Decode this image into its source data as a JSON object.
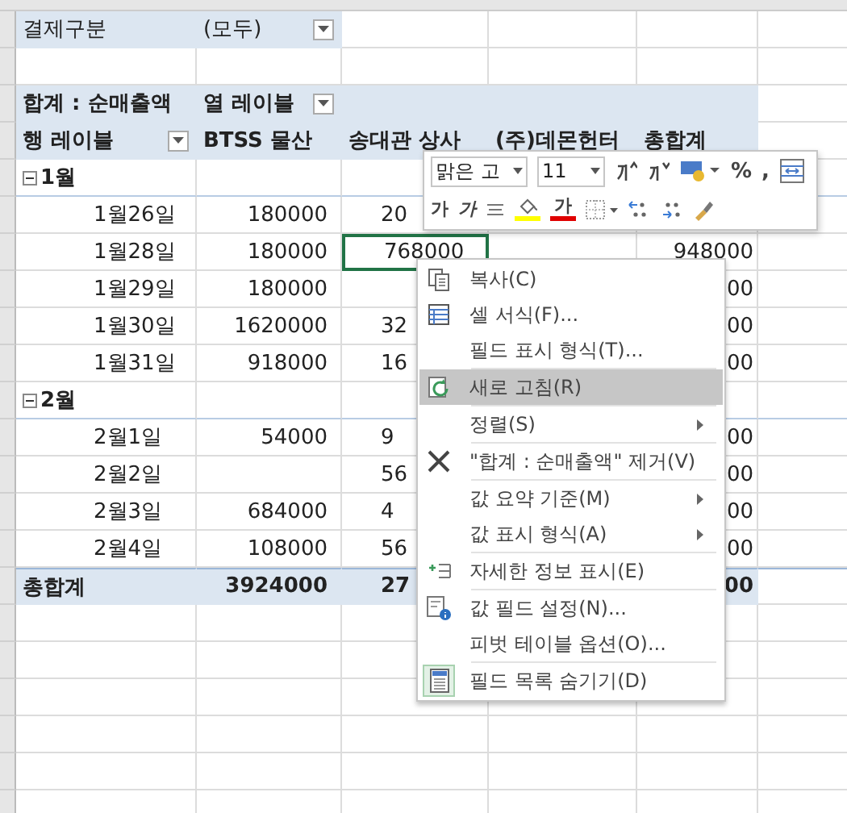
{
  "page_filter": {
    "label": "결제구분",
    "value": "(모두)"
  },
  "pivot": {
    "value_label": "합계 : 순매출액",
    "column_label": "열 레이블",
    "row_label": "행 레이블",
    "columns": [
      "BTSS 물산",
      "송대관 상사",
      "(주)데몬헌터",
      "총합계"
    ],
    "groups": [
      {
        "label": "1월",
        "expanded": true,
        "rows": [
          {
            "label": "1월26일",
            "col_1": "180000",
            "col_2": "20",
            "selected_cells": [
              false,
              false,
              false,
              false
            ]
          },
          {
            "label": "1월28일",
            "col_1": "180000",
            "col_2": "768000",
            "col_4": "948000",
            "selected_cells": [
              false,
              true,
              false,
              false
            ]
          },
          {
            "label": "1월29일",
            "col_1": "180000",
            "col_4": "00",
            "selected_cells": [
              false,
              false,
              false,
              false
            ]
          },
          {
            "label": "1월30일",
            "col_1": "1620000",
            "col_2": "32",
            "col_4": "00",
            "selected_cells": [
              false,
              false,
              false,
              false
            ]
          },
          {
            "label": "1월31일",
            "col_1": "918000",
            "col_2": "16",
            "col_4": "00",
            "selected_cells": [
              false,
              false,
              false,
              false
            ]
          }
        ]
      },
      {
        "label": "2월",
        "expanded": true,
        "rows": [
          {
            "label": "2월1일",
            "col_1": "54000",
            "col_2": "9",
            "col_4": "00",
            "selected_cells": [
              false,
              false,
              false,
              false
            ]
          },
          {
            "label": "2월2일",
            "col_2": "56",
            "col_4": "00",
            "selected_cells": [
              false,
              false,
              false,
              false
            ]
          },
          {
            "label": "2월3일",
            "col_1": "684000",
            "col_2": "4",
            "col_4": "00",
            "selected_cells": [
              false,
              false,
              false,
              false
            ]
          },
          {
            "label": "2월4일",
            "col_1": "108000",
            "col_2": "56",
            "col_4": "00",
            "selected_cells": [
              false,
              false,
              false,
              false
            ]
          }
        ]
      }
    ],
    "grand_total": {
      "label": "총합계",
      "col_1": "3924000",
      "col_2": "27",
      "col_4": "00"
    }
  },
  "mini_toolbar": {
    "font": "맑은 고",
    "size": "11",
    "rows": [
      [
        {
          "kind": "grow"
        },
        {
          "kind": "shrink"
        },
        {
          "kind": "accounting"
        },
        {
          "kind": "text",
          "text": "%"
        },
        {
          "kind": "text",
          "text": ","
        },
        {
          "kind": "wrap"
        }
      ],
      [
        {
          "kind": "bold",
          "text": "가"
        },
        {
          "kind": "italic",
          "text": "가"
        },
        {
          "kind": "align"
        },
        {
          "kind": "fill",
          "color": "#ffff00"
        },
        {
          "kind": "fontcolor",
          "text": "가",
          "color": "#e00000"
        },
        {
          "kind": "border"
        },
        {
          "kind": "incdec"
        },
        {
          "kind": "decdec"
        },
        {
          "kind": "painter"
        }
      ]
    ]
  },
  "context_menu": [
    {
      "kind": "item",
      "label": "복사(C)",
      "submenu": false,
      "selected": false
    },
    {
      "kind": "item",
      "label": "셀 서식(F)...",
      "submenu": false,
      "selected": false
    },
    {
      "kind": "item",
      "label": "필드 표시 형식(T)...",
      "submenu": false,
      "selected": false
    },
    {
      "kind": "separator"
    },
    {
      "kind": "item",
      "label": "새로 고침(R)",
      "submenu": false,
      "selected": true
    },
    {
      "kind": "separator"
    },
    {
      "kind": "item",
      "label": "정렬(S)",
      "submenu": true,
      "selected": false
    },
    {
      "kind": "separator"
    },
    {
      "kind": "item",
      "label": "\"합계 : 순매출액\" 제거(V)",
      "submenu": false,
      "selected": false
    },
    {
      "kind": "separator"
    },
    {
      "kind": "item",
      "label": "값 요약 기준(M)",
      "submenu": true,
      "selected": false
    },
    {
      "kind": "item",
      "label": "값 표시 형식(A)",
      "submenu": true,
      "selected": false
    },
    {
      "kind": "separator"
    },
    {
      "kind": "item",
      "label": "자세한 정보 표시(E)",
      "submenu": false,
      "selected": false
    },
    {
      "kind": "separator"
    },
    {
      "kind": "item",
      "label": "값 필드 설정(N)...",
      "submenu": false,
      "selected": false
    },
    {
      "kind": "item",
      "label": "피벗 테이블 옵션(O)...",
      "submenu": false,
      "selected": false
    },
    {
      "kind": "separator"
    },
    {
      "kind": "item",
      "label": "필드 목록 숨기기(D)",
      "submenu": false,
      "selected": false,
      "checked": true
    }
  ]
}
